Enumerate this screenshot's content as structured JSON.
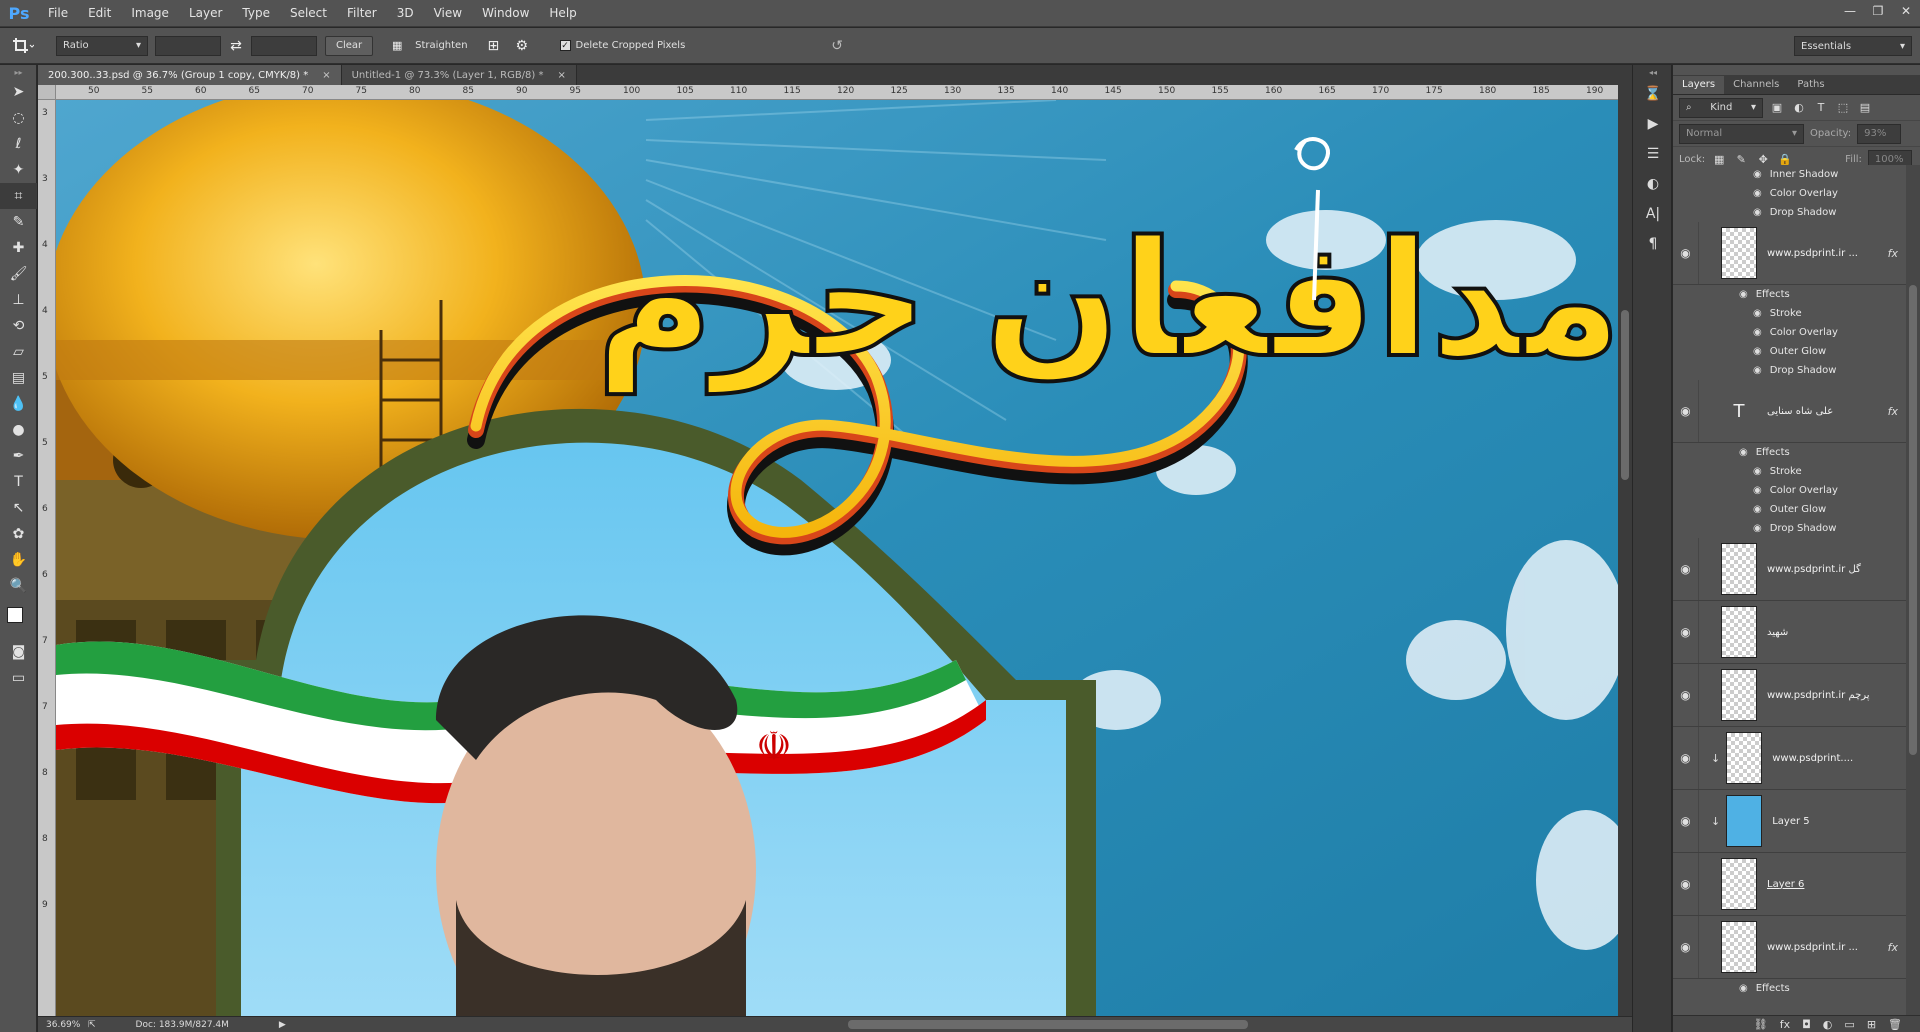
{
  "app": {
    "logo": "Ps"
  },
  "menu": [
    "File",
    "Edit",
    "Image",
    "Layer",
    "Type",
    "Select",
    "Filter",
    "3D",
    "View",
    "Window",
    "Help"
  ],
  "window_controls": {
    "minimize": "—",
    "restore": "❐",
    "close": "✕"
  },
  "options": {
    "ratio_label": "Ratio",
    "clear_label": "Clear",
    "straighten_label": "Straighten",
    "delete_cropped_label": "Delete Cropped Pixels",
    "delete_cropped_checked": true,
    "workspace": "Essentials"
  },
  "tabs": [
    {
      "label": "200.300..33.psd @ 36.7% (Group 1 copy, CMYK/8) *",
      "active": true,
      "close": "×"
    },
    {
      "label": "Untitled-1 @ 73.3% (Layer 1, RGB/8) *",
      "active": false,
      "close": "×"
    }
  ],
  "ruler_h": [
    "50",
    "55",
    "60",
    "65",
    "70",
    "75",
    "80",
    "85",
    "90",
    "95",
    "100",
    "105",
    "110",
    "115",
    "120",
    "125",
    "130",
    "135",
    "140",
    "145",
    "150",
    "155",
    "160",
    "165",
    "170",
    "175",
    "180",
    "185",
    "190"
  ],
  "ruler_v": [
    "3",
    "3",
    "4",
    "4",
    "5",
    "5",
    "6",
    "6",
    "7",
    "7",
    "8",
    "8",
    "9"
  ],
  "canvas": {
    "calligraphy": "مدافعان حرم"
  },
  "status": {
    "zoom": "36.69%",
    "doc": "Doc: 183.9M/827.4M"
  },
  "panel": {
    "tabs": [
      "Layers",
      "Channels",
      "Paths"
    ],
    "kind_label": "Kind",
    "blend_mode": "Normal",
    "opacity_label": "Opacity:",
    "opacity_value": "93%",
    "lock_label": "Lock:",
    "fill_label": "Fill:",
    "fill_value": "100%"
  },
  "layers": [
    {
      "type": "effects-only",
      "effects": [
        "Inner Shadow",
        "Color Overlay",
        "Drop Shadow"
      ]
    },
    {
      "type": "layer",
      "name": "www.psdprint.ir ...",
      "fx": "fx",
      "effects_label": "Effects",
      "effects": [
        "Stroke",
        "Color Overlay",
        "Outer Glow",
        "Drop Shadow"
      ]
    },
    {
      "type": "text",
      "name": "علی شاه سنایی",
      "fx": "fx",
      "icon": "T",
      "effects_label": "Effects",
      "effects": [
        "Stroke",
        "Color Overlay",
        "Outer Glow",
        "Drop Shadow"
      ]
    },
    {
      "type": "layer",
      "name": "www.psdprint.ir  گل"
    },
    {
      "type": "layer",
      "name": "شهید"
    },
    {
      "type": "layer",
      "name": "www.psdprint.ir پرچم"
    },
    {
      "type": "layer",
      "name": "www.psdprint....",
      "clipped": true
    },
    {
      "type": "layer",
      "name": "Layer 5",
      "clipped": true
    },
    {
      "type": "layer",
      "name": "Layer 6"
    },
    {
      "type": "layer",
      "name": "www.psdprint.ir ...",
      "fx": "fx",
      "effects_label": "Effects"
    }
  ],
  "colors": {
    "accent": "#4ea8ff",
    "panel": "#535353",
    "dark": "#282828"
  }
}
